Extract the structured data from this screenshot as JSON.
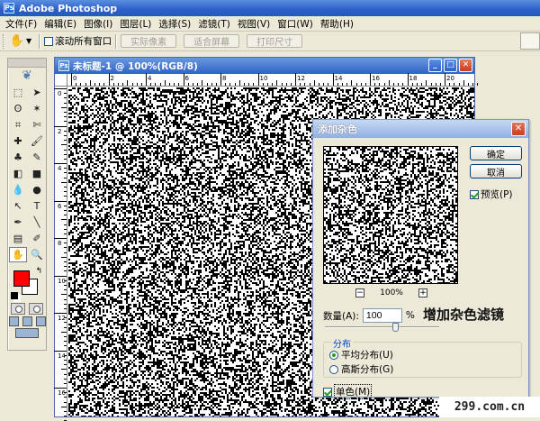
{
  "app": {
    "title": "Adobe Photoshop",
    "logo_text": "Ps"
  },
  "menu": [
    "文件(F)",
    "编辑(E)",
    "图像(I)",
    "图层(L)",
    "选择(S)",
    "滤镜(T)",
    "视图(V)",
    "窗口(W)",
    "帮助(H)"
  ],
  "options": {
    "scroll_all_label": "滚动所有窗口",
    "actual_pixels": "实际像素",
    "fit_screen": "适合屏幕",
    "print_size": "打印尺寸"
  },
  "document": {
    "title": "未标题-1 @ 100%(RGB/8)",
    "ruler_top": [
      "0",
      "2",
      "4",
      "6",
      "8",
      "10",
      "12",
      "14",
      "16",
      "18",
      "20"
    ],
    "ruler_left": [
      "0",
      "2",
      "4",
      "6",
      "8",
      "10",
      "12",
      "14",
      "16"
    ]
  },
  "colors": {
    "foreground": "#ff0000",
    "background": "#ffffff",
    "title_blue": "#2d63c8"
  },
  "dialog": {
    "title": "添加杂色",
    "ok_label": "确定",
    "cancel_label": "取消",
    "preview_label": "预览(P)",
    "preview_checked": true,
    "zoom_value": "100%",
    "zoom_minus": "−",
    "zoom_plus": "+",
    "amount_label": "数量(A):",
    "amount_value": "100",
    "amount_unit": "%",
    "amount_level": 0.25,
    "distribution_legend": "分布",
    "uniform_label": "平均分布(U)",
    "gaussian_label": "高斯分布(G)",
    "selected_distribution": "uniform",
    "monochromatic_label": "单色(M)",
    "monochromatic_checked": true
  },
  "caption": "增加杂色滤镜",
  "watermark": "299.com.cn",
  "tools": [
    "marquee-icon",
    "move-icon",
    "lasso-icon",
    "magic-wand-icon",
    "crop-icon",
    "slice-icon",
    "healing-brush-icon",
    "brush-icon",
    "clone-stamp-icon",
    "history-brush-icon",
    "eraser-icon",
    "gradient-icon",
    "blur-icon",
    "dodge-icon",
    "path-selection-icon",
    "type-icon",
    "pen-icon",
    "line-icon",
    "notes-icon",
    "eyedropper-icon",
    "hand-icon",
    "zoom-icon"
  ]
}
